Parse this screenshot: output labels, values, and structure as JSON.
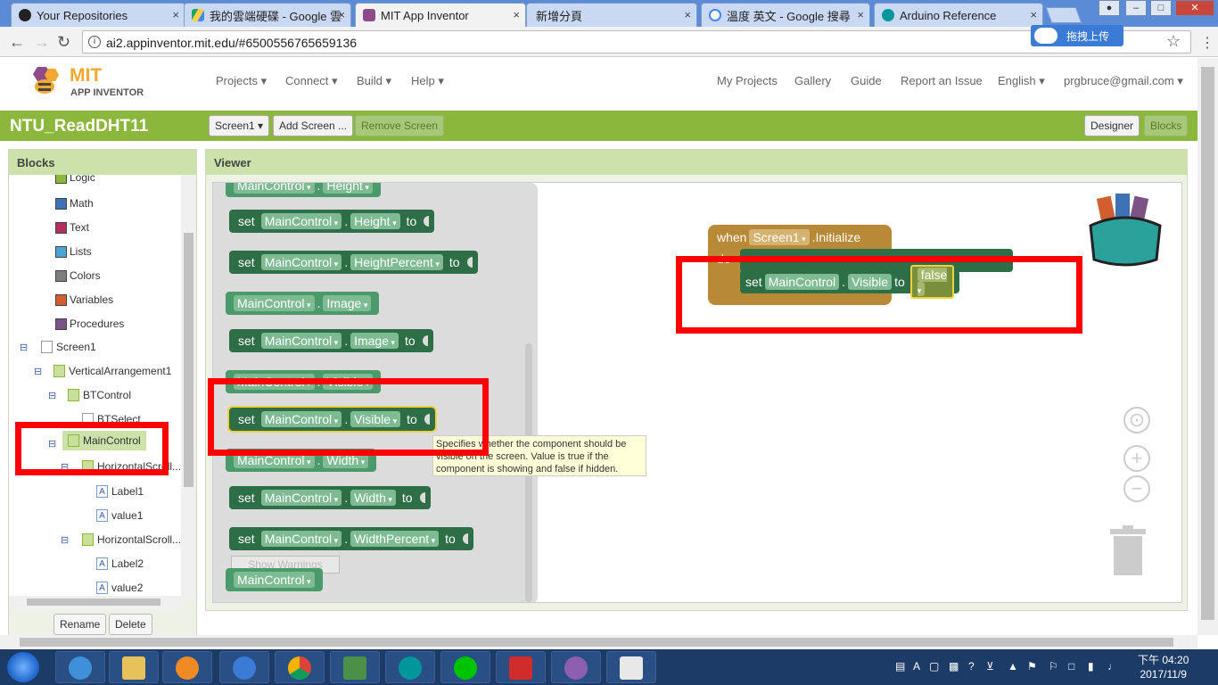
{
  "browser": {
    "tabs": [
      {
        "title": "Your Repositories",
        "close": "×"
      },
      {
        "title": "我的雲端硬碟 - Google 雲",
        "close": "×"
      },
      {
        "title": "MIT App Inventor",
        "close": "×"
      },
      {
        "title": "新增分頁",
        "close": "×"
      },
      {
        "title": "溫度 英文 - Google 搜尋",
        "close": "×"
      },
      {
        "title": "Arduino Reference",
        "close": "×"
      }
    ],
    "url": "ai2.appinventor.mit.edu/#6500556765659136",
    "upload_label": "拖拽上传"
  },
  "app": {
    "logo_title": "MIT",
    "logo_subtitle": "APP INVENTOR",
    "menu": [
      "Projects ▾",
      "Connect ▾",
      "Build ▾",
      "Help ▾"
    ],
    "right_links": [
      "My Projects",
      "Gallery",
      "Guide",
      "Report an Issue",
      "English ▾",
      "prgbruce@gmail.com ▾"
    ]
  },
  "project": {
    "name": "NTU_ReadDHT11",
    "screen_select": "Screen1 ▾",
    "add_screen": "Add Screen ...",
    "remove_screen": "Remove Screen",
    "designer": "Designer",
    "blocks": "Blocks"
  },
  "blocks_panel": {
    "title": "Blocks",
    "builtin": [
      {
        "label": "Logic",
        "color": "#8ab73c"
      },
      {
        "label": "Math",
        "color": "#3f71b5"
      },
      {
        "label": "Text",
        "color": "#b32d5e"
      },
      {
        "label": "Lists",
        "color": "#49a6d4"
      },
      {
        "label": "Colors",
        "color": "#7d7d7d"
      },
      {
        "label": "Variables",
        "color": "#d05f2d"
      },
      {
        "label": "Procedures",
        "color": "#7c5385"
      }
    ],
    "components": {
      "screen": "Screen1",
      "va": "VerticalArrangement1",
      "bt": "BTControl",
      "btselect": "BTSelect",
      "main": "MainControl",
      "ha1": "HorizontalScroll...",
      "label1": "Label1",
      "value1": "value1",
      "ha2": "HorizontalScroll...",
      "label2": "Label2",
      "value2": "value2"
    },
    "rename": "Rename",
    "delete": "Delete"
  },
  "viewer": {
    "title": "Viewer",
    "flyout": {
      "comp": "MainControl",
      "set_word": "set",
      "to_word": "to",
      "dot": ".",
      "props": {
        "height": "Height",
        "height_pct": "HeightPercent",
        "image": "Image",
        "visible": "Visible",
        "width": "Width",
        "width_pct": "WidthPercent"
      },
      "show_warnings": "Show Warnings"
    },
    "event_block": {
      "when": "when",
      "screen": "Screen1",
      "event": ".Initialize",
      "do": "do",
      "set_word": "set",
      "comp": "MainControl",
      "prop": "Visible",
      "to_word": "to",
      "value": "false"
    },
    "tooltip": "Specifies whether the component should be visible on the screen. Value is true if the component is showing and false if hidden."
  },
  "taskbar": {
    "clock_line1": "下午 04:20",
    "clock_line2": "2017/11/9"
  },
  "colors": {
    "accent_green": "#8ab73c",
    "highlight_red": "#ff0000",
    "set_block": "#2e6e47",
    "get_block": "#4b9a6b",
    "event_block": "#b88a38"
  }
}
